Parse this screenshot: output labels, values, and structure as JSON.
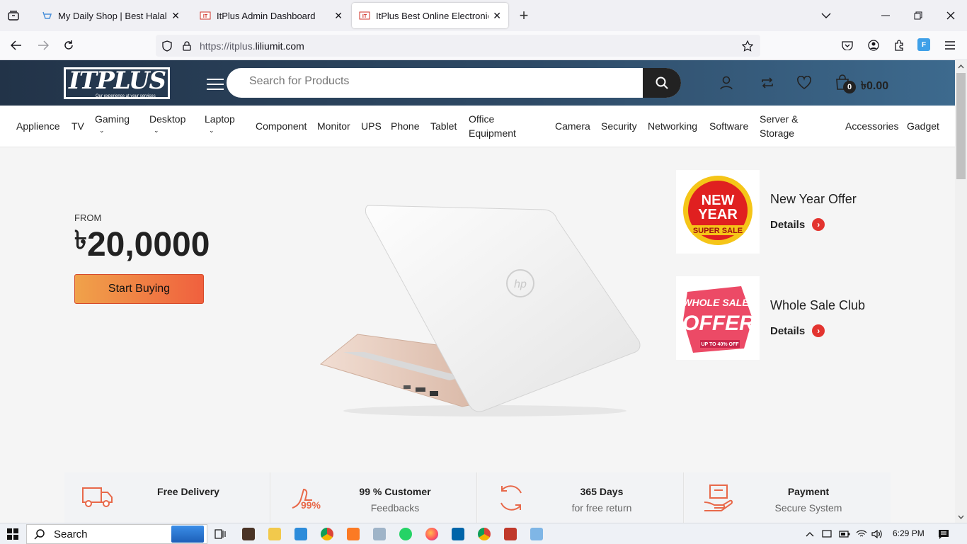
{
  "browser": {
    "tabs": [
      {
        "title": "My Daily Shop | Best Halal Shop",
        "active": false
      },
      {
        "title": "ItPlus Admin Dashboard",
        "active": false
      },
      {
        "title": "ItPlus Best Online Electronics Sh",
        "active": true
      }
    ],
    "url_prefix": "https://itplus.",
    "url_domain": "liliumit.com",
    "close_glyph": "✕",
    "new_tab_glyph": "+"
  },
  "site": {
    "logo_text": "ITPLUS",
    "logo_tagline": "Our experience at your services",
    "search_placeholder": "Search for Products",
    "cart_count": "0",
    "cart_total": "৳0.00",
    "categories": [
      {
        "label": "Applience"
      },
      {
        "label": "TV"
      },
      {
        "label": "Gaming",
        "caret": "⌄"
      },
      {
        "label": "Desktop",
        "caret": "⌄"
      },
      {
        "label": "Laptop",
        "caret": "⌄"
      },
      {
        "label": "Component"
      },
      {
        "label": "Monitor"
      },
      {
        "label": "UPS"
      },
      {
        "label": "Phone"
      },
      {
        "label": "Tablet"
      },
      {
        "label": "Office Equipment"
      },
      {
        "label": "Camera"
      },
      {
        "label": "Security"
      },
      {
        "label": "Networking"
      },
      {
        "label": "Software"
      },
      {
        "label": "Server & Storage"
      },
      {
        "label": "Accessories"
      },
      {
        "label": "Gadget"
      }
    ]
  },
  "hero": {
    "from_label": "FROM",
    "currency": "৳",
    "price": "20,0000",
    "cta": "Start Buying",
    "laptop_logo": "hp"
  },
  "promos": [
    {
      "title": "New Year Offer",
      "link": "Details",
      "badge_line1": "NEW",
      "badge_line2": "YEAR",
      "badge_ribbon": "SUPER SALE"
    },
    {
      "title": "Whole Sale Club",
      "link": "Details",
      "badge_line1": "WHOLE SALE",
      "badge_line2": "OFFER",
      "badge_ribbon": "UP TO 40% OFF"
    }
  ],
  "features": [
    {
      "title": "Free Delivery",
      "subtitle": "",
      "icon": "truck-icon"
    },
    {
      "title": "99 % Customer",
      "subtitle": "Feedbacks",
      "icon": "thumbs-up-icon",
      "icon_text": "99%"
    },
    {
      "title": "365 Days",
      "subtitle": "for free return",
      "icon": "return-cycle-icon"
    },
    {
      "title": "Payment",
      "subtitle": "Secure System",
      "icon": "secure-payment-icon"
    }
  ],
  "taskbar": {
    "search_label": "Search",
    "time": "6:29 PM"
  },
  "colors": {
    "header_start": "#223348",
    "header_end": "#3d6a8e",
    "accent_orange": "#f0603e",
    "icon_orange": "#e8694a"
  }
}
